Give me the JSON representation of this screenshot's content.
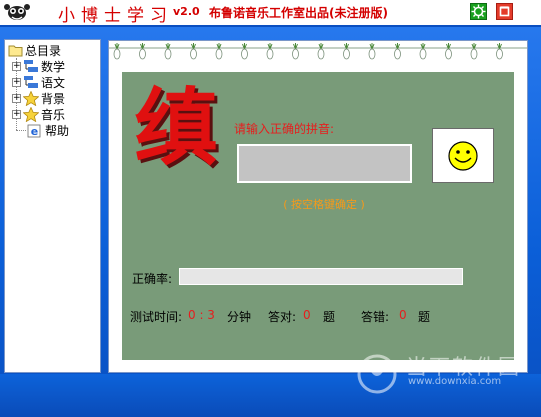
{
  "titlebar": {
    "title": "小博士学习",
    "version": "v2.0",
    "publisher": "布鲁诺音乐工作室出品(未注册版)",
    "settings_icon": "settings-icon",
    "close_icon": "close-icon",
    "settings_color": "#19a01e",
    "close_color": "#e43b2a"
  },
  "tree": {
    "root": "总目录",
    "items": [
      {
        "label": "数学",
        "icon": "tree-node-icon"
      },
      {
        "label": "语文",
        "icon": "tree-node-icon"
      },
      {
        "label": "背景",
        "icon": "star-icon"
      },
      {
        "label": "音乐",
        "icon": "star-icon"
      },
      {
        "label": "帮助",
        "icon": "ie-help-icon"
      }
    ]
  },
  "main": {
    "character": "缜",
    "prompt": "请输入正确的拼音:",
    "pinyin_value": "",
    "hint": "( 按空格键确定 )",
    "rate_label": "正确率:",
    "rate_value": "",
    "time_label": "测试时间:",
    "time_value": "0 : 3",
    "time_unit": "分钟",
    "correct_label": "答对:",
    "correct_value": "0",
    "correct_unit": "题",
    "wrong_label": "答错:",
    "wrong_value": "0",
    "wrong_unit": "题",
    "smiley_icon": "smiley-icon",
    "board_color": "#799b79",
    "char_color": "#e01010"
  },
  "watermark": {
    "text": "当下软件园",
    "url": "www.downxia.com"
  }
}
